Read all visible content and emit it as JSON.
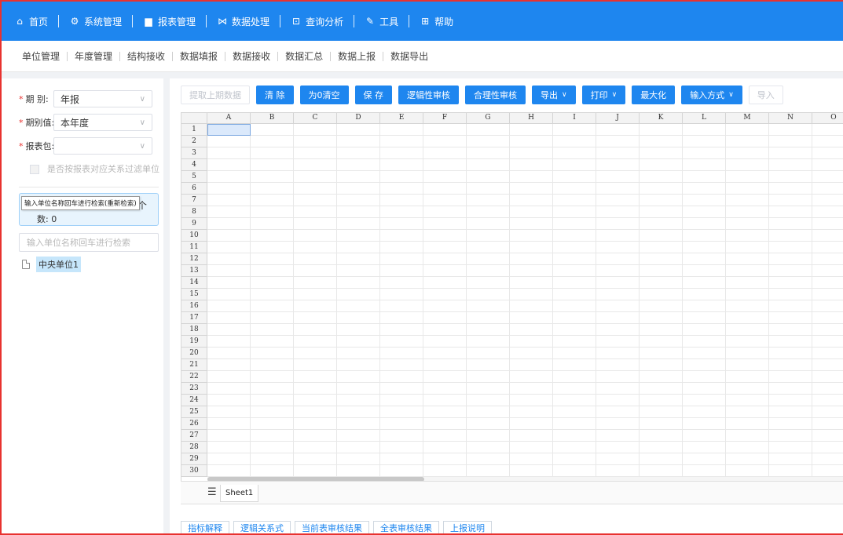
{
  "topnav": {
    "items": [
      {
        "icon": "home-icon",
        "glyph": "⌂",
        "label": "首页"
      },
      {
        "icon": "gear-icon",
        "glyph": "⚙",
        "label": "系统管理"
      },
      {
        "icon": "chart-icon",
        "glyph": "▆",
        "label": "报表管理"
      },
      {
        "icon": "data-icon",
        "glyph": "⋈",
        "label": "数据处理"
      },
      {
        "icon": "query-icon",
        "glyph": "⊡",
        "label": "查询分析"
      },
      {
        "icon": "wrench-icon",
        "glyph": "✎",
        "label": "工具"
      },
      {
        "icon": "help-icon",
        "glyph": "⊞",
        "label": "帮助"
      }
    ]
  },
  "subnav": {
    "items": [
      "单位管理",
      "年度管理",
      "结构接收",
      "数据填报",
      "数据接收",
      "数据汇总",
      "数据上报",
      "数据导出"
    ]
  },
  "left": {
    "period_label": "期 别:",
    "period_value": "年报",
    "period_value_label": "期别值:",
    "period_value_value": "本年度",
    "package_label": "报表包:",
    "package_value": "",
    "filter_checkbox_label": "是否按报表对应关系过滤单位",
    "tooltip": "输入单位名称回车进行检索(重新检索)",
    "tooltip_suffix": "个",
    "count_text": "数: 0",
    "search_placeholder": "输入单位名称回车进行检索",
    "tree_node": "中央单位1"
  },
  "toolbar": {
    "fetch_prev": "提取上期数据",
    "clear": "清 除",
    "clear_zero": "为0清空",
    "save": "保 存",
    "logic_check": "逻辑性审核",
    "reason_check": "合理性审核",
    "export": "导出",
    "print": "打印",
    "maximize": "最大化",
    "input_mode": "输入方式",
    "import": "导入"
  },
  "sheet": {
    "columns": [
      "A",
      "B",
      "C",
      "D",
      "E",
      "F",
      "G",
      "H",
      "I",
      "J",
      "K",
      "L",
      "M",
      "N",
      "O"
    ],
    "rows": [
      "1",
      "2",
      "3",
      "4",
      "5",
      "6",
      "7",
      "8",
      "9",
      "10",
      "11",
      "12",
      "13",
      "14",
      "15",
      "16",
      "17",
      "18",
      "19",
      "20",
      "21",
      "22",
      "23",
      "24",
      "25",
      "26",
      "27",
      "28",
      "29",
      "30"
    ],
    "selected_cell": "A1",
    "tab_name": "Sheet1"
  },
  "bottom_tabs": [
    "指标解释",
    "逻辑关系式",
    "当前表审核结果",
    "全表审核结果",
    "上报说明"
  ]
}
